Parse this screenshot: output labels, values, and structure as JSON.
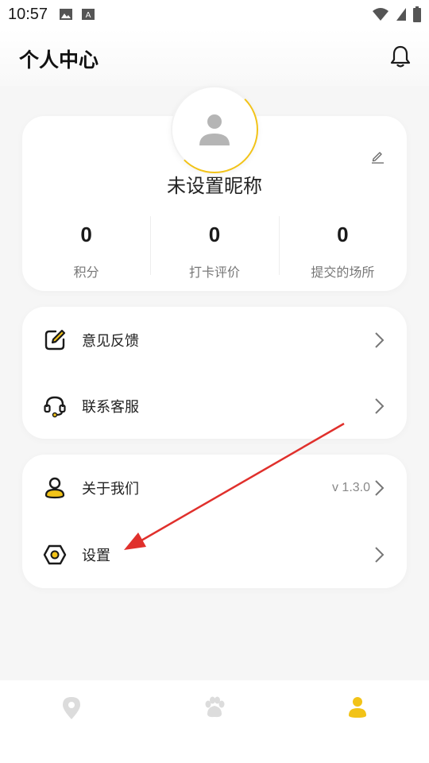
{
  "status_bar": {
    "time": "10:57"
  },
  "header": {
    "title": "个人中心"
  },
  "profile": {
    "nickname": "未设置昵称"
  },
  "stats": [
    {
      "value": "0",
      "label": "积分"
    },
    {
      "value": "0",
      "label": "打卡评价"
    },
    {
      "value": "0",
      "label": "提交的场所"
    }
  ],
  "menu": {
    "feedback": {
      "label": "意见反馈"
    },
    "customer_service": {
      "label": "联系客服"
    },
    "about": {
      "label": "关于我们",
      "value": "v 1.3.0"
    },
    "settings": {
      "label": "设置"
    }
  },
  "colors": {
    "accent": "#f2c318",
    "arrow": "#e0302c",
    "text": "#1a1a1a",
    "muted": "#888888"
  },
  "bottom_nav": {
    "items": [
      {
        "icon": "location-pin-icon",
        "active": false
      },
      {
        "icon": "paw-icon",
        "active": false
      },
      {
        "icon": "profile-icon",
        "active": true
      }
    ]
  }
}
